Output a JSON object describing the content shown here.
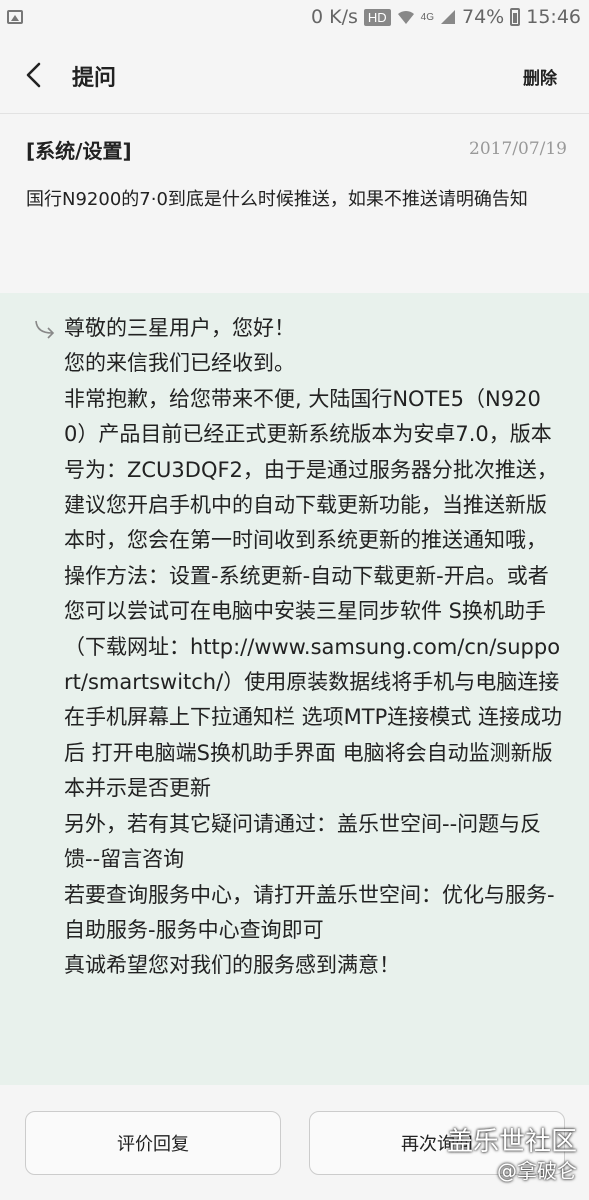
{
  "status_bar": {
    "network_speed": "0 K/s",
    "hd_badge": "HD",
    "network_type": "4G",
    "battery": "74%",
    "time": "15:46"
  },
  "app_bar": {
    "title": "提问",
    "delete_label": "删除"
  },
  "question": {
    "category": "[系统/设置]",
    "date": "2017/07/19",
    "text": "国行N9200的7·0到底是什么时候推送，如果不推送请明确告知"
  },
  "reply": {
    "lines": [
      "尊敬的三星用户，您好！",
      "您的来信我们已经收到。",
      "非常抱歉，给您带来不便, 大陆国行NOTE5（N9200）产品目前已经正式更新系统版本为安卓7.0，版本号为：ZCU3DQF2，由于是通过服务器分批次推送，建议您开启手机中的自动下载更新功能，当推送新版本时，您会在第一时间收到系统更新的推送通知哦，操作方法：设置-系统更新-自动下载更新-开启。或者您可以尝试可在电脑中安装三星同步软件 S换机助手（下载网址：http://www.samsung.com/cn/support/smartswitch/）使用原装数据线将手机与电脑连接 在手机屏幕上下拉通知栏 选项MTP连接模式 连接成功后 打开电脑端S换机助手界面 电脑将会自动监测新版本并示是否更新",
      "另外，若有其它疑问请通过：盖乐世空间--问题与反馈--留言咨询",
      "若要查询服务中心，请打开盖乐世空间：优化与服务-自助服务-服务中心查询即可",
      "真诚希望您对我们的服务感到满意！"
    ]
  },
  "actions": {
    "rate_label": "评价回复",
    "ask_again_label": "再次询问"
  },
  "watermark": {
    "main": "盖乐世社区",
    "sub": "@拿破仑"
  },
  "icons": {
    "back": "chevron-left-icon",
    "reply": "reply-arrow-icon",
    "gallery": "gallery-icon",
    "wifi": "wifi-icon",
    "signal": "signal-icon",
    "battery": "battery-icon"
  }
}
